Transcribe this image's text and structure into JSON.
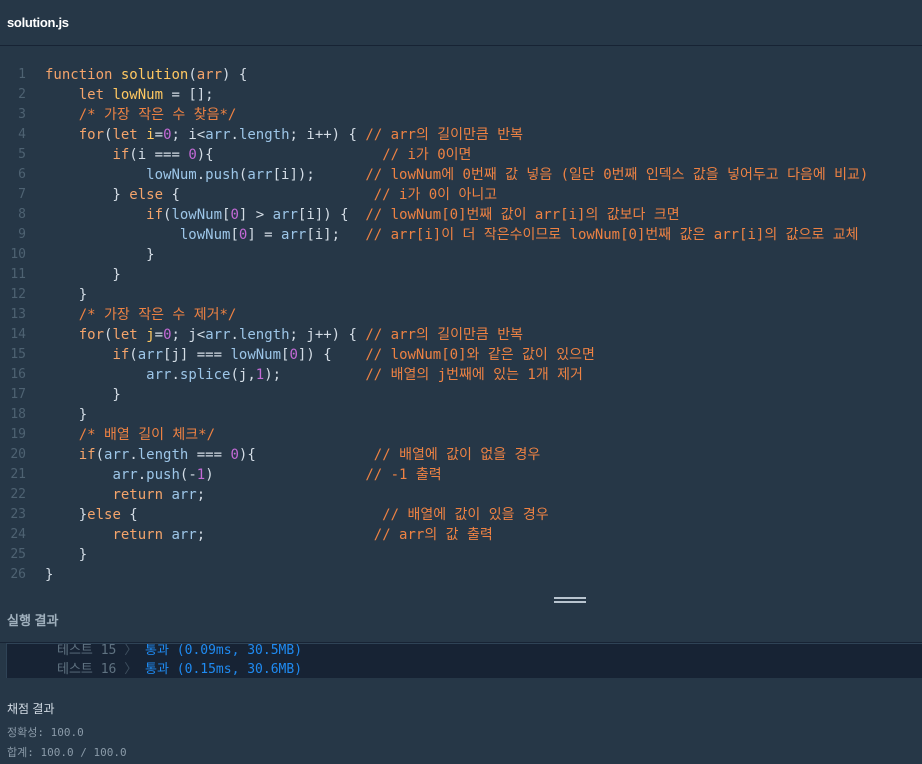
{
  "header": {
    "file_name": "solution.js"
  },
  "editor": {
    "line_numbers": [
      "1",
      "2",
      "3",
      "4",
      "5",
      "6",
      "7",
      "8",
      "9",
      "10",
      "11",
      "12",
      "13",
      "14",
      "15",
      "16",
      "17",
      "18",
      "19",
      "20",
      "21",
      "22",
      "23",
      "24",
      "25",
      "26"
    ]
  },
  "result_panel": {
    "title": "실행 결과",
    "tests": [
      {
        "label": "테스트 15",
        "arrow": "〉",
        "status": "통과 (0.09ms, 30.5MB)"
      },
      {
        "label": "테스트 16",
        "arrow": "〉",
        "status": "통과 (0.15ms, 30.6MB)"
      }
    ]
  },
  "grading": {
    "title": "채점 결과",
    "accuracy": "정확성: 100.0",
    "total": "합계: 100.0 / 100.0"
  }
}
